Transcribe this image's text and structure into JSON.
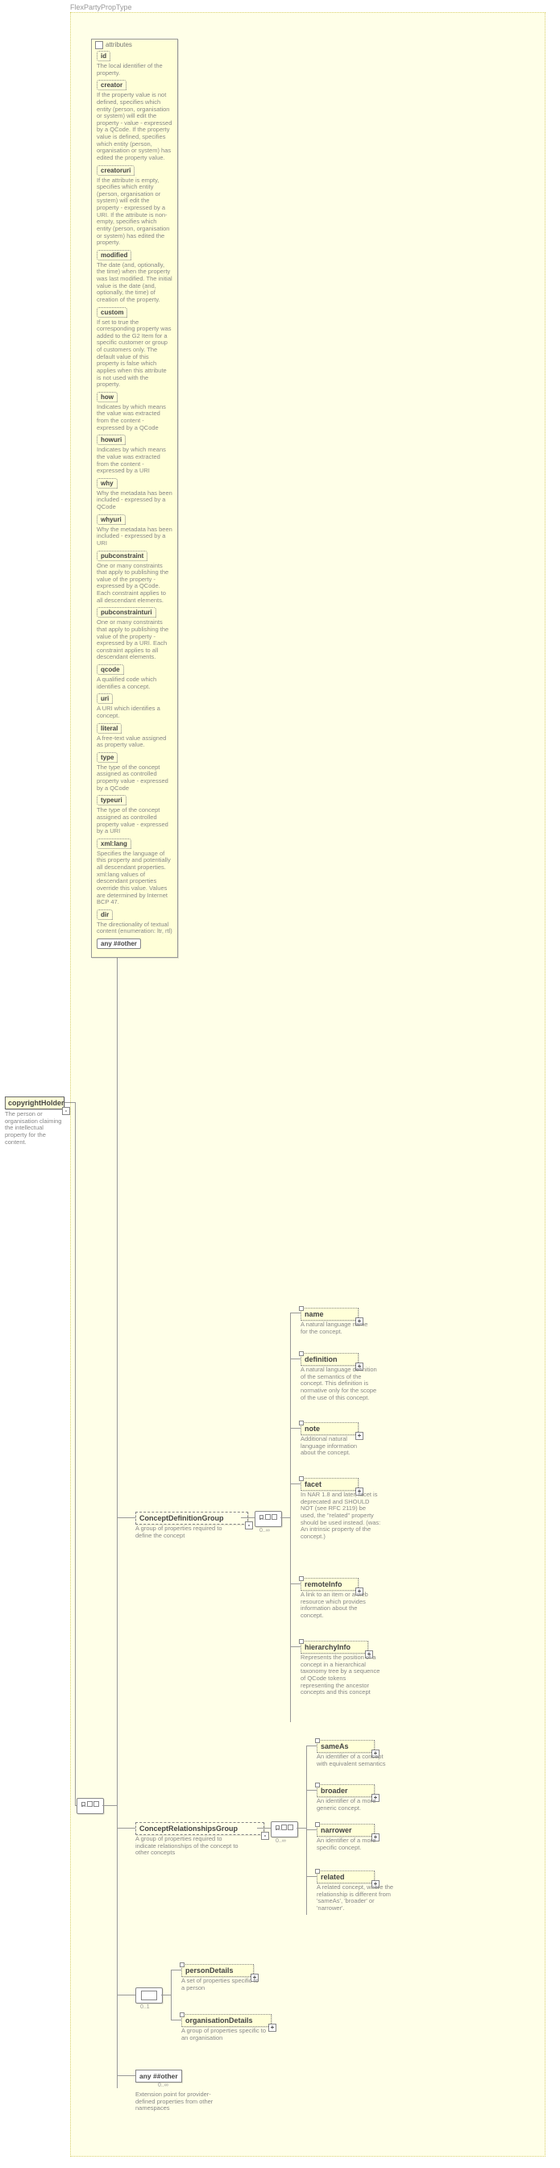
{
  "typeName": "FlexPartyPropType",
  "root": {
    "name": "copyrightHolder",
    "desc": "The person or organisation claiming the intellectual property for the content."
  },
  "attributes": {
    "label": "attributes",
    "items": [
      {
        "name": "id",
        "desc": "The local identifier of the property."
      },
      {
        "name": "creator",
        "desc": "If the property value is not defined, specifies which entity (person, organisation or system) will edit the property - value - expressed by a QCode. If the property value is defined, specifies which entity (person, organisation or system) has edited the property value."
      },
      {
        "name": "creatoruri",
        "desc": "If the attribute is empty, specifies which entity (person, organisation or system) will edit the property - expressed by a URI. If the attribute is non-empty, specifies which entity (person, organisation or system) has edited the property."
      },
      {
        "name": "modified",
        "desc": "The date (and, optionally, the time) when the property was last modified. The initial value is the date (and, optionally, the time) of creation of the property."
      },
      {
        "name": "custom",
        "desc": "If set to true the corresponding property was added to the G2 Item for a specific customer or group of customers only. The default value of this property is false which applies when this attribute is not used with the property."
      },
      {
        "name": "how",
        "desc": "Indicates by which means the value was extracted from the content - expressed by a QCode"
      },
      {
        "name": "howuri",
        "desc": "Indicates by which means the value was extracted from the content - expressed by a URI"
      },
      {
        "name": "why",
        "desc": "Why the metadata has been included - expressed by a QCode"
      },
      {
        "name": "whyuri",
        "desc": "Why the metadata has been included - expressed by a URI"
      },
      {
        "name": "pubconstraint",
        "desc": "One or many constraints that apply to publishing the value of the property - expressed by a QCode. Each constraint applies to all descendant elements."
      },
      {
        "name": "pubconstrainturi",
        "desc": "One or many constraints that apply to publishing the value of the property - expressed by a URI. Each constraint applies to all descendant elements."
      },
      {
        "name": "qcode",
        "desc": "A qualified code which identifies a concept."
      },
      {
        "name": "uri",
        "desc": "A URI which identifies a concept."
      },
      {
        "name": "literal",
        "desc": "A free-text value assigned as property value."
      },
      {
        "name": "type",
        "desc": "The type of the concept assigned as controlled property value - expressed by a QCode"
      },
      {
        "name": "typeuri",
        "desc": "The type of the concept assigned as controlled property value - expressed by a URI"
      },
      {
        "name": "xml:lang",
        "desc": "Specifies the language of this property and potentially all descendant properties. xml:lang values of descendant properties override this value. Values are determined by Internet BCP 47."
      },
      {
        "name": "dir",
        "desc": "The directionality of textual content (enumeration: ltr, rtl)"
      }
    ],
    "any": "any ##other"
  },
  "groups": {
    "conceptDef": {
      "name": "ConceptDefinitionGroup",
      "desc": "A group of properties required to define the concept"
    },
    "conceptRel": {
      "name": "ConceptRelationshipsGroup",
      "desc": "A group of properties required to indicate relationships of the concept to other concepts"
    }
  },
  "defGroup": {
    "name": {
      "label": "name",
      "desc": "A natural language name for the concept."
    },
    "definition": {
      "label": "definition",
      "desc": "A natural language definition of the semantics of the concept. This definition is normative only for the scope of the use of this concept."
    },
    "note": {
      "label": "note",
      "desc": "Additional natural language information about the concept."
    },
    "facet": {
      "label": "facet",
      "desc": "In NAR 1.8 and later, facet is deprecated and SHOULD NOT (see RFC 2119) be used, the \"related\" property should be used instead. (was: An intrinsic property of the concept.)"
    },
    "remoteInfo": {
      "label": "remoteInfo",
      "desc": "A link to an item or a web resource which provides information about the concept."
    },
    "hierarchyInfo": {
      "label": "hierarchyInfo",
      "desc": "Represents the position of a concept in a hierarchical taxonomy tree by a sequence of QCode tokens representing the ancestor concepts and this concept"
    }
  },
  "relGroup": {
    "sameAs": {
      "label": "sameAs",
      "desc": "An identifier of a concept with equivalent semantics"
    },
    "broader": {
      "label": "broader",
      "desc": "An identifier of a more generic concept."
    },
    "narrower": {
      "label": "narrower",
      "desc": "An identifier of a more specific concept."
    },
    "related": {
      "label": "related",
      "desc": "A related concept, where the relationship is different from 'sameAs', 'broader' or 'narrower'."
    }
  },
  "personOrg": {
    "person": {
      "label": "personDetails",
      "desc": "A set of properties specific to a person"
    },
    "org": {
      "label": "organisationDetails",
      "desc": "A group of properties specific to an organisation"
    }
  },
  "anyOther": {
    "label": "any ##other",
    "desc": "Extension point for provider-defined properties from other namespaces"
  },
  "cardInfinity": "0..∞",
  "cardSingle": "0..1"
}
